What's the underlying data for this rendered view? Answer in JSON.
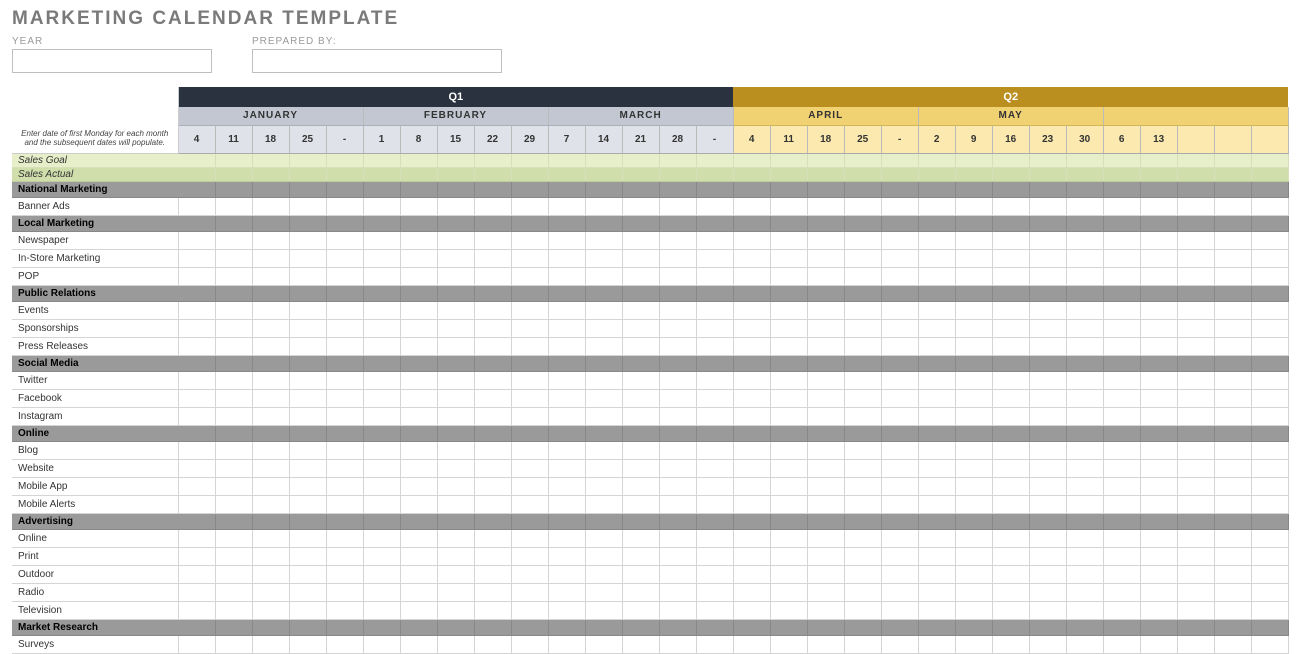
{
  "title": "MARKETING CALENDAR TEMPLATE",
  "inputs": {
    "year_label": "YEAR",
    "year_value": "",
    "prepared_by_label": "PREPARED BY:",
    "prepared_by_value": ""
  },
  "first_col_note": "Enter date of first Monday for each month and the subsequent dates will populate.",
  "quarters": [
    {
      "label": "Q1",
      "class": "q1",
      "span": 15
    },
    {
      "label": "Q2",
      "class": "q2",
      "span": 15
    }
  ],
  "months": [
    {
      "label": "JANUARY",
      "q": "q1m",
      "span": 5
    },
    {
      "label": "FEBRUARY",
      "q": "q1m",
      "span": 5
    },
    {
      "label": "MARCH",
      "q": "q1m",
      "span": 5
    },
    {
      "label": "APRIL",
      "q": "q2m",
      "span": 5
    },
    {
      "label": "MAY",
      "q": "q2m",
      "span": 5
    },
    {
      "label": "",
      "q": "q2m",
      "span": 5
    }
  ],
  "dates": [
    {
      "d": "4",
      "q": "q1d"
    },
    {
      "d": "11",
      "q": "q1d"
    },
    {
      "d": "18",
      "q": "q1d"
    },
    {
      "d": "25",
      "q": "q1d"
    },
    {
      "d": "-",
      "q": "q1d"
    },
    {
      "d": "1",
      "q": "q1d"
    },
    {
      "d": "8",
      "q": "q1d"
    },
    {
      "d": "15",
      "q": "q1d"
    },
    {
      "d": "22",
      "q": "q1d"
    },
    {
      "d": "29",
      "q": "q1d"
    },
    {
      "d": "7",
      "q": "q1d"
    },
    {
      "d": "14",
      "q": "q1d"
    },
    {
      "d": "21",
      "q": "q1d"
    },
    {
      "d": "28",
      "q": "q1d"
    },
    {
      "d": "-",
      "q": "q1d"
    },
    {
      "d": "4",
      "q": "q2d"
    },
    {
      "d": "11",
      "q": "q2d"
    },
    {
      "d": "18",
      "q": "q2d"
    },
    {
      "d": "25",
      "q": "q2d"
    },
    {
      "d": "-",
      "q": "q2d"
    },
    {
      "d": "2",
      "q": "q2d"
    },
    {
      "d": "9",
      "q": "q2d"
    },
    {
      "d": "16",
      "q": "q2d"
    },
    {
      "d": "23",
      "q": "q2d"
    },
    {
      "d": "30",
      "q": "q2d"
    },
    {
      "d": "6",
      "q": "q2d"
    },
    {
      "d": "13",
      "q": "q2d"
    },
    {
      "d": "",
      "q": "q2d"
    },
    {
      "d": "",
      "q": "q2d"
    },
    {
      "d": "",
      "q": "q2d"
    }
  ],
  "rows": [
    {
      "type": "sales",
      "label": "Sales Goal"
    },
    {
      "type": "salesA",
      "label": "Sales Actual"
    },
    {
      "type": "cat",
      "label": "National Marketing"
    },
    {
      "type": "item",
      "label": "Banner Ads"
    },
    {
      "type": "cat",
      "label": "Local Marketing"
    },
    {
      "type": "item",
      "label": "Newspaper"
    },
    {
      "type": "item",
      "label": "In-Store Marketing"
    },
    {
      "type": "item",
      "label": "POP"
    },
    {
      "type": "cat",
      "label": "Public Relations"
    },
    {
      "type": "item",
      "label": "Events"
    },
    {
      "type": "item",
      "label": "Sponsorships"
    },
    {
      "type": "item",
      "label": "Press Releases"
    },
    {
      "type": "cat",
      "label": "Social Media"
    },
    {
      "type": "item",
      "label": "Twitter"
    },
    {
      "type": "item",
      "label": "Facebook"
    },
    {
      "type": "item",
      "label": "Instagram"
    },
    {
      "type": "cat",
      "label": "Online"
    },
    {
      "type": "item",
      "label": "Blog"
    },
    {
      "type": "item",
      "label": "Website"
    },
    {
      "type": "item",
      "label": "Mobile App"
    },
    {
      "type": "item",
      "label": "Mobile Alerts"
    },
    {
      "type": "cat",
      "label": "Advertising"
    },
    {
      "type": "item",
      "label": "Online"
    },
    {
      "type": "item",
      "label": "Print"
    },
    {
      "type": "item",
      "label": "Outdoor"
    },
    {
      "type": "item",
      "label": "Radio"
    },
    {
      "type": "item",
      "label": "Television"
    },
    {
      "type": "cat",
      "label": "Market Research"
    },
    {
      "type": "item",
      "label": "Surveys"
    }
  ]
}
